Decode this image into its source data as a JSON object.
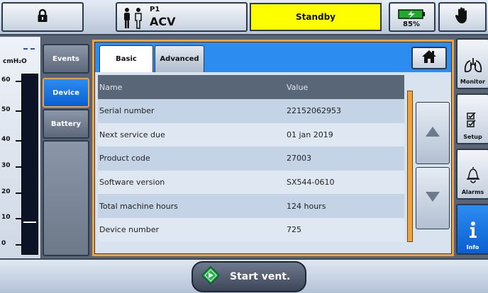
{
  "topbar": {
    "lock_icon": "lock-icon",
    "patient_label": "P1",
    "mode": "ACV",
    "status": "Standby",
    "status_color": "#ffff00",
    "battery_percent": "85%",
    "battery_icon": "battery-charging-icon",
    "alarm_silence_icon": "hand-stop-icon"
  },
  "gauge": {
    "unit": "cmH₂O",
    "ticks": [
      "60",
      "50",
      "40",
      "30",
      "20",
      "10",
      "0"
    ],
    "current_level": 4,
    "max": 65,
    "target_marker": "---"
  },
  "sidemenu": {
    "items": [
      {
        "label": "Events"
      },
      {
        "label": "Device"
      },
      {
        "label": "Battery"
      }
    ]
  },
  "tabs": {
    "basic": "Basic",
    "advanced": "Advanced"
  },
  "table": {
    "headers": [
      "Name",
      "Value"
    ],
    "rows": [
      {
        "name": "Serial number",
        "value": "22152062953"
      },
      {
        "name": "Next service due",
        "value": "01 jan 2019"
      },
      {
        "name": "Product code",
        "value": "27003"
      },
      {
        "name": "Software version",
        "value": "SX544-0610"
      },
      {
        "name": "Total machine hours",
        "value": "124 hours"
      },
      {
        "name": "Device number",
        "value": "725"
      }
    ]
  },
  "rightnav": {
    "items": [
      {
        "label": "Monitor",
        "icon": "lungs-icon"
      },
      {
        "label": "Setup",
        "icon": "checklist-icon"
      },
      {
        "label": "Alarms",
        "icon": "bell-icon"
      },
      {
        "label": "Info",
        "icon": "info-icon"
      }
    ]
  },
  "bottombar": {
    "start_label": "Start vent."
  },
  "colors": {
    "accent_blue": "#2d8cf0",
    "orange_frame": "#f2a23a",
    "panel_gray": "#5a6475"
  }
}
